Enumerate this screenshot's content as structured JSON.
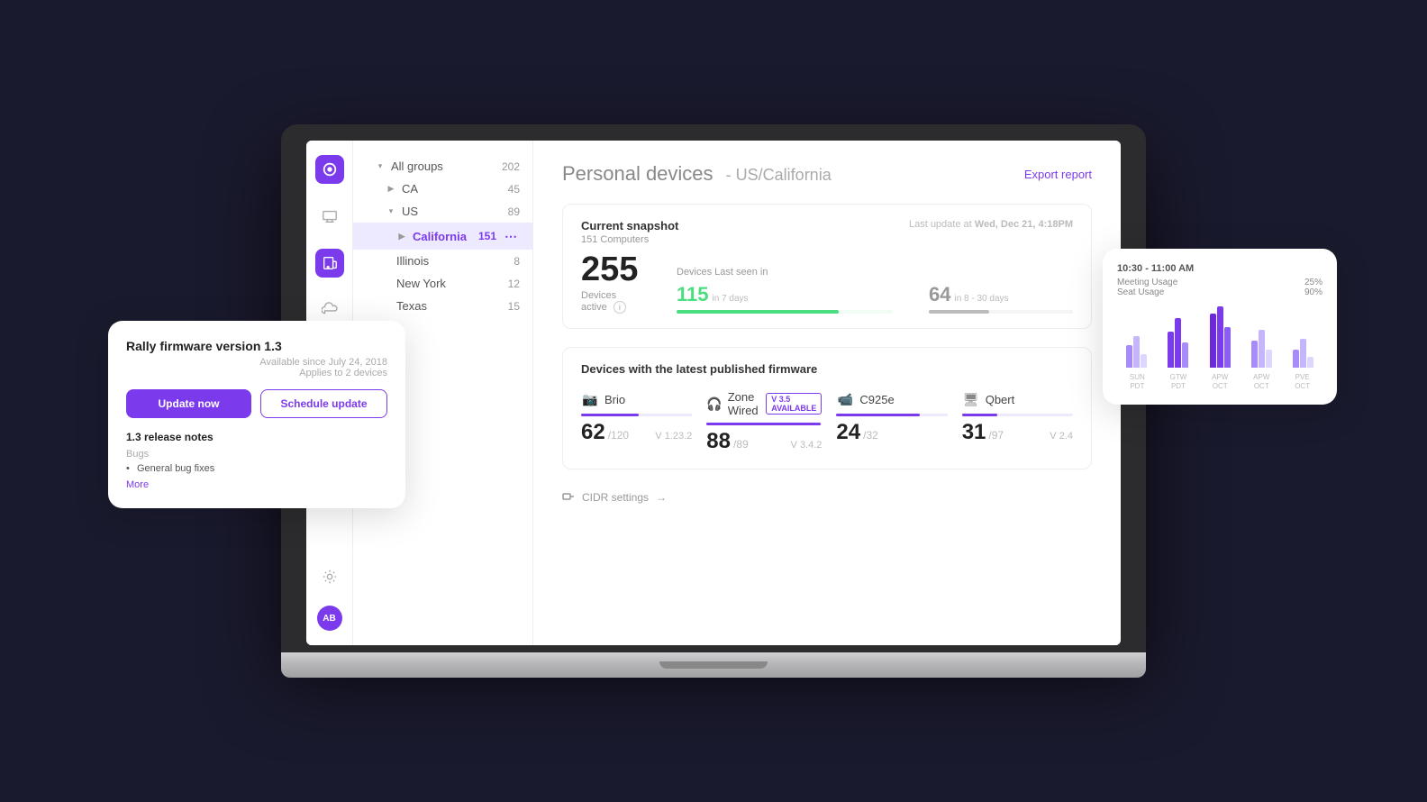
{
  "app": {
    "title": "Personal devices",
    "subtitle": "- US/California"
  },
  "sidebar": {
    "icons": [
      "logo",
      "devices",
      "monitor",
      "cloud-download",
      "cloud"
    ],
    "bottom_icons": [
      "settings",
      "avatar"
    ],
    "avatar_text": "AB"
  },
  "nav": {
    "items": [
      {
        "label": "All groups",
        "count": "202",
        "level": 0,
        "expanded": true,
        "icon": "chevron-down"
      },
      {
        "label": "CA",
        "count": "45",
        "level": 1,
        "expanded": false,
        "icon": "chevron-right"
      },
      {
        "label": "US",
        "count": "89",
        "level": 1,
        "expanded": true,
        "icon": "chevron-down"
      },
      {
        "label": "California",
        "count": "151",
        "level": 2,
        "selected": true,
        "icon": "chevron-right"
      },
      {
        "label": "Illinois",
        "count": "8",
        "level": 2
      },
      {
        "label": "New York",
        "count": "12",
        "level": 2
      },
      {
        "label": "Texas",
        "count": "15",
        "level": 2
      }
    ]
  },
  "snapshot": {
    "title": "Current snapshot",
    "subtitle": "151 Computers",
    "last_update_label": "Last update at",
    "last_update_value": "Wed, Dec 21, 4:18PM",
    "devices_active": "255",
    "devices_active_label": "Devices active",
    "devices_last_seen_label": "Devices Last seen in",
    "stat_7days": "115",
    "stat_7days_label": "in 7 days",
    "stat_30days": "64",
    "stat_30days_label": "in 8 - 30 days",
    "progress_7days_pct": 75,
    "progress_30days_pct": 42
  },
  "firmware": {
    "section_title": "Devices with the latest published firmware",
    "devices": [
      {
        "name": "Brio",
        "count": "62",
        "total": "/120",
        "version": "V 1.23.2",
        "progress": 52,
        "badge": null,
        "icon": "camera"
      },
      {
        "name": "Zone Wired",
        "count": "88",
        "total": "/89",
        "version": "V 3.4.2",
        "progress": 99,
        "badge": "V 3.5 AVAILABLE",
        "icon": "headphones"
      },
      {
        "name": "C925e",
        "count": "24",
        "total": "/32",
        "version": null,
        "progress": 75,
        "badge": null,
        "icon": "webcam"
      },
      {
        "name": "Qbert",
        "count": "31",
        "total": "/97",
        "version": "V 2.4",
        "progress": 32,
        "badge": null,
        "icon": "device"
      }
    ]
  },
  "footer": {
    "cidr_label": "CIDR settings",
    "icon": "arrow-right"
  },
  "firmware_overlay": {
    "title": "Rally firmware version 1.3",
    "available_since": "Available since July 24, 2018",
    "applies_to": "Applies to 2 devices",
    "update_now_label": "Update now",
    "schedule_update_label": "Schedule update",
    "release_notes_title": "1.3 release notes",
    "bugs_label": "Bugs",
    "bug_items": [
      "General bug fixes"
    ],
    "more_label": "More"
  },
  "chart_overlay": {
    "time_label": "10:30 - 11:00 AM",
    "meeting_usage_label": "Meeting Usage",
    "meeting_usage_pct": "25%",
    "seat_usage_label": "Seat Usage",
    "seat_usage_pct": "90%",
    "dates": [
      {
        "day": "SUN",
        "date": "PDT"
      },
      {
        "day": "GTW",
        "date": "PDT"
      },
      {
        "day": "APW",
        "date": "OCT"
      },
      {
        "day": "APW",
        "date": "OCT"
      },
      {
        "day": "PVE",
        "date": "OCT"
      }
    ],
    "bar_groups": [
      [
        30,
        45,
        20
      ],
      [
        50,
        70,
        35
      ],
      [
        80,
        90,
        60
      ],
      [
        40,
        55,
        30
      ],
      [
        25,
        40,
        15
      ]
    ]
  },
  "colors": {
    "brand": "#7c3aed",
    "brand_light": "#ede9fe",
    "green": "#4ade80",
    "gray": "#999",
    "border": "#eee"
  }
}
